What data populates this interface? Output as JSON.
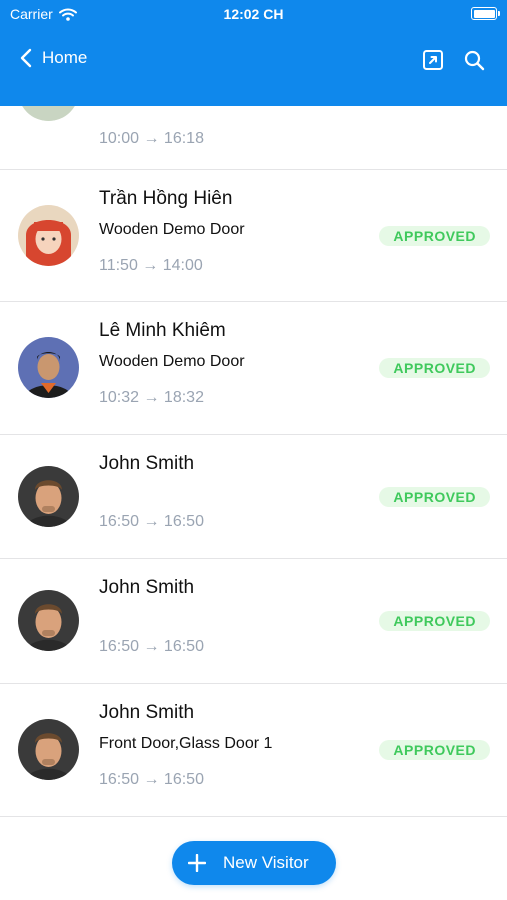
{
  "status_bar": {
    "carrier": "Carrier",
    "time": "12:02 CH"
  },
  "nav": {
    "back_label": "Home",
    "icons": [
      "chevron-left-icon",
      "open-external-icon",
      "search-icon"
    ]
  },
  "colors": {
    "primary": "#0f88ec",
    "approved_text": "#3fc95c",
    "approved_bg": "#e6f9e6",
    "time_text": "#9aa4b2",
    "divider": "#e4e4e6"
  },
  "visitors": [
    {
      "name": "",
      "door": "",
      "time": "10:00 → 16:18",
      "status": ""
    },
    {
      "name": "Trần Hồng Hiên",
      "door": "Wooden Demo Door",
      "time": "11:50 → 14:00",
      "status": "APPROVED"
    },
    {
      "name": "Lê Minh Khiêm",
      "door": "Wooden Demo Door",
      "time": "10:32 → 18:32",
      "status": "APPROVED"
    },
    {
      "name": "John Smith",
      "door": "",
      "time": "16:50 → 16:50",
      "status": "APPROVED"
    },
    {
      "name": "John Smith",
      "door": "",
      "time": "16:50 → 16:50",
      "status": "APPROVED"
    },
    {
      "name": "John Smith",
      "door": "Front Door,Glass Door 1",
      "time": "16:50 → 16:50",
      "status": "APPROVED"
    }
  ],
  "new_visitor_label": "New Visitor"
}
